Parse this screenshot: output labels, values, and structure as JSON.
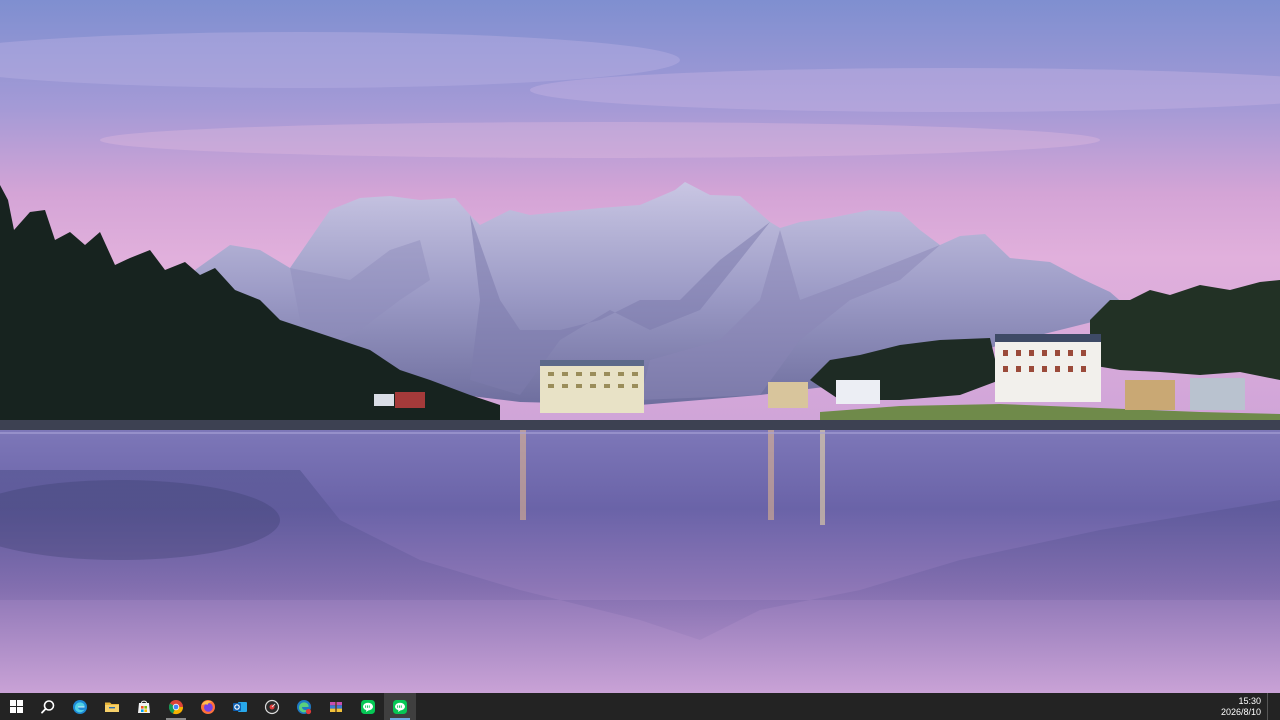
{
  "desktop": {
    "wallpaper": "mountain-lake-twilight"
  },
  "taskbar": {
    "items": [
      {
        "name": "start-button",
        "icon": "windows-logo-icon"
      },
      {
        "name": "search-button",
        "icon": "search-icon"
      },
      {
        "name": "edge-button",
        "icon": "edge-icon"
      },
      {
        "name": "file-explorer-button",
        "icon": "folder-icon"
      },
      {
        "name": "store-button",
        "icon": "store-icon"
      },
      {
        "name": "chrome-button",
        "icon": "chrome-icon"
      },
      {
        "name": "firefox-button",
        "icon": "firefox-icon"
      },
      {
        "name": "outlook-button",
        "icon": "outlook-icon"
      },
      {
        "name": "recorder-button",
        "icon": "recorder-icon"
      },
      {
        "name": "edge-beta-button",
        "icon": "edge-beta-icon"
      },
      {
        "name": "archive-button",
        "icon": "archive-icon"
      },
      {
        "name": "line-button",
        "icon": "line-icon"
      },
      {
        "name": "line-active-button",
        "icon": "line-icon"
      }
    ],
    "clock": {
      "time": "15:30",
      "date": "2026/8/10"
    }
  },
  "colors": {
    "taskbar_bg": "#232323",
    "accent_indicator": "#6da7e0"
  }
}
